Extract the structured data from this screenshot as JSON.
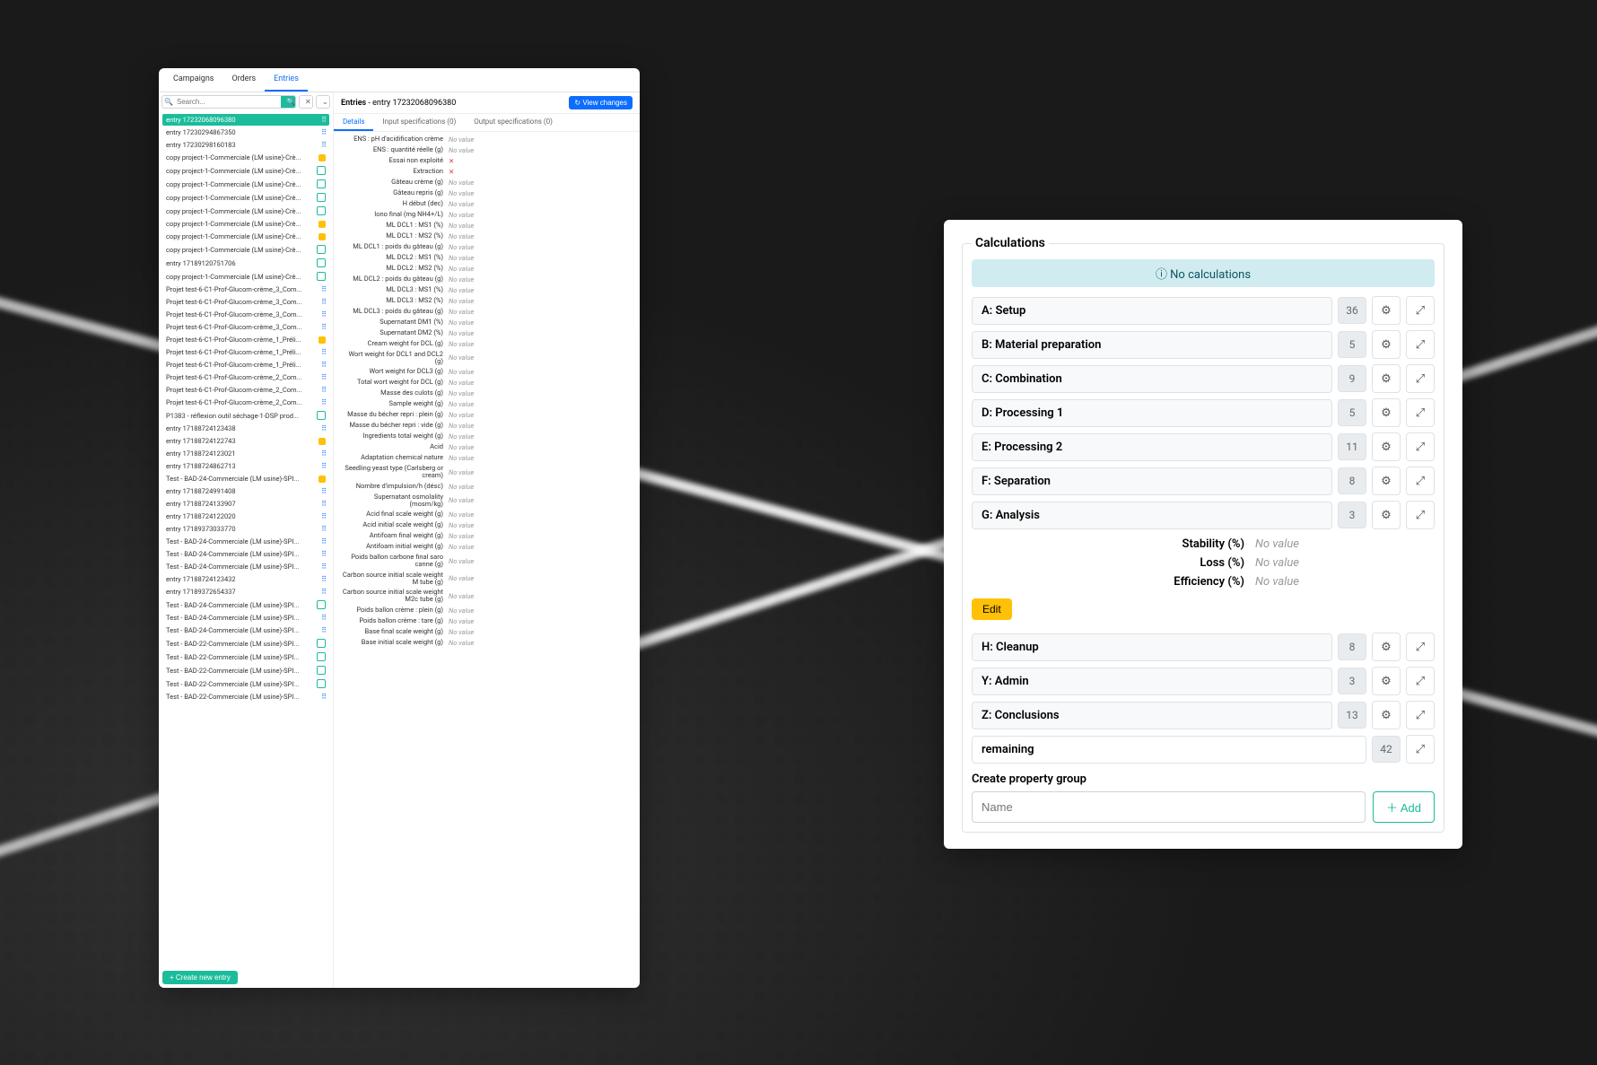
{
  "leftWindow": {
    "tabs": [
      "Campaigns",
      "Orders",
      "Entries"
    ],
    "activeTab": 2,
    "search": {
      "placeholder": "Search..."
    },
    "createLabel": "+  Create new entry",
    "entries": [
      {
        "label": "entry 17232068096380",
        "icon": "drag",
        "sel": true
      },
      {
        "label": "entry 17230294867350",
        "icon": "drag"
      },
      {
        "label": "entry 17230298160183",
        "icon": "drag"
      },
      {
        "label": "copy project-1-Commerciale (LM usine)-Crè...",
        "icon": "y"
      },
      {
        "label": "copy project-1-Commerciale (LM usine)-Crè...",
        "icon": "g"
      },
      {
        "label": "copy project-1-Commerciale (LM usine)-Crè...",
        "icon": "g"
      },
      {
        "label": "copy project-1-Commerciale (LM usine)-Crè...",
        "icon": "g"
      },
      {
        "label": "copy project-1-Commerciale (LM usine)-Crè...",
        "icon": "g"
      },
      {
        "label": "copy project-1-Commerciale (LM usine)-Crè...",
        "icon": "y"
      },
      {
        "label": "copy project-1-Commerciale (LM usine)-Crè...",
        "icon": "y"
      },
      {
        "label": "copy project-1-Commerciale (LM usine)-Crè...",
        "icon": "g"
      },
      {
        "label": "entry 17189120751706",
        "icon": "g"
      },
      {
        "label": "copy project-1-Commerciale (LM usine)-Crè...",
        "icon": "g"
      },
      {
        "label": "Projet test-6-C1-Prof-Glucom-crème_3_Com...",
        "icon": "drag"
      },
      {
        "label": "Projet test-6-C1-Prof-Glucom-crème_3_Com...",
        "icon": "drag"
      },
      {
        "label": "Projet test-6-C1-Prof-Glucom-crème_3_Com...",
        "icon": "drag"
      },
      {
        "label": "Projet test-6-C1-Prof-Glucom-crème_3_Com...",
        "icon": "drag"
      },
      {
        "label": "Projet test-6-C1-Prof-Glucom-crème_1_Préli...",
        "icon": "y"
      },
      {
        "label": "Projet test-6-C1-Prof-Glucom-crème_1_Préli...",
        "icon": "drag"
      },
      {
        "label": "Projet test-6-C1-Prof-Glucom-crème_1_Préli...",
        "icon": "drag"
      },
      {
        "label": "Projet test-6-C1-Prof-Glucom-crème_2_Com...",
        "icon": "drag"
      },
      {
        "label": "Projet test-6-C1-Prof-Glucom-crème_2_Com...",
        "icon": "drag"
      },
      {
        "label": "Projet test-6-C1-Prof-Glucom-crème_2_Com...",
        "icon": "drag"
      },
      {
        "label": "P1383 - réflexion outil séchage-1-DSP prod...",
        "icon": "g"
      },
      {
        "label": "entry 17188724123438",
        "icon": "drag"
      },
      {
        "label": "entry 17188724122743",
        "icon": "y"
      },
      {
        "label": "entry 17188724123021",
        "icon": "drag"
      },
      {
        "label": "entry 17188724862713",
        "icon": "drag"
      },
      {
        "label": "Test - BAD-24-Commerciale (LM usine)-SPI...",
        "icon": "y"
      },
      {
        "label": "entry 17188724991408",
        "icon": "drag"
      },
      {
        "label": "entry 17188724133907",
        "icon": "drag"
      },
      {
        "label": "entry 17188724122020",
        "icon": "drag"
      },
      {
        "label": "entry 17189373033770",
        "icon": "drag"
      },
      {
        "label": "Test - BAD-24-Commerciale (LM usine)-SPI...",
        "icon": "drag"
      },
      {
        "label": "Test - BAD-24-Commerciale (LM usine)-SPI...",
        "icon": "drag"
      },
      {
        "label": "Test - BAD-24-Commerciale (LM usine)-SPI...",
        "icon": "drag"
      },
      {
        "label": "entry 17188724123432",
        "icon": "drag"
      },
      {
        "label": "entry 17189372654337",
        "icon": "drag"
      },
      {
        "label": "Test - BAD-24-Commerciale (LM usine)-SPI...",
        "icon": "g"
      },
      {
        "label": "Test - BAD-24-Commerciale (LM usine)-SPI...",
        "icon": "drag"
      },
      {
        "label": "Test - BAD-24-Commerciale (LM usine)-SPI...",
        "icon": "drag"
      },
      {
        "label": "Test - BAD-22-Commerciale (LM usine)-SPI...",
        "icon": "g"
      },
      {
        "label": "Test - BAD-22-Commerciale (LM usine)-SPI...",
        "icon": "g"
      },
      {
        "label": "Test - BAD-22-Commerciale (LM usine)-SPI...",
        "icon": "g"
      },
      {
        "label": "Test - BAD-22-Commerciale (LM usine)-SPI...",
        "icon": "g"
      },
      {
        "label": "Test - BAD-22-Commerciale (LM usine)-SPI...",
        "icon": "drag"
      }
    ],
    "rightHeader": {
      "prefix": "Entries",
      "sep": " - ",
      "name": "entry 17232068096380",
      "viewBtn": "↻ View changes"
    },
    "subTabs": [
      "Details",
      "Input specifications (0)",
      "Output specifications (0)"
    ],
    "activeSubTab": 0,
    "details": [
      {
        "l": "ENS : pH d'acidification crème",
        "v": "No value"
      },
      {
        "l": "ENS : quantité réelle (g)",
        "v": "No value"
      },
      {
        "l": "Essai non exploité",
        "v": "✕",
        "x": true
      },
      {
        "l": "Extraction",
        "v": "✕",
        "x": true
      },
      {
        "l": "Gâteau crème (g)",
        "v": "No value"
      },
      {
        "l": "Gâteau repris (g)",
        "v": "No value"
      },
      {
        "l": "H début (dec)",
        "v": "No value"
      },
      {
        "l": "Iono final (mg NH4+/L)",
        "v": "No value"
      },
      {
        "l": "ML DCL1 : MS1 (%)",
        "v": "No value"
      },
      {
        "l": "ML DCL1 : MS2 (%)",
        "v": "No value"
      },
      {
        "l": "ML DCL1 : poids du gâteau (g)",
        "v": "No value"
      },
      {
        "l": "ML DCL2 : MS1 (%)",
        "v": "No value"
      },
      {
        "l": "ML DCL2 : MS2 (%)",
        "v": "No value"
      },
      {
        "l": "ML DCL2 : poids du gâteau (g)",
        "v": "No value"
      },
      {
        "l": "ML DCL3 : MS1 (%)",
        "v": "No value"
      },
      {
        "l": "ML DCL3 : MS2 (%)",
        "v": "No value"
      },
      {
        "l": "ML DCL3 : poids du gâteau (g)",
        "v": "No value"
      },
      {
        "l": "Supernatant DM1 (%)",
        "v": "No value"
      },
      {
        "l": "Supernatant DM2 (%)",
        "v": "No value"
      },
      {
        "l": "Cream weight for DCL (g)",
        "v": "No value"
      },
      {
        "l": "Wort weight for DCL1 and DCL2 (g)",
        "v": "No value"
      },
      {
        "l": "Wort weight for DCL3 (g)",
        "v": "No value"
      },
      {
        "l": "Total wort weight for DCL (g)",
        "v": "No value"
      },
      {
        "l": "Masse des culots (g)",
        "v": "No value"
      },
      {
        "l": "Sample weight (g)",
        "v": "No value"
      },
      {
        "l": "Masse du bécher repri : plein (g)",
        "v": "No value"
      },
      {
        "l": "Masse du bécher repri : vide (g)",
        "v": "No value"
      },
      {
        "l": "Ingredients total weight (g)",
        "v": "No value"
      },
      {
        "l": "Acid",
        "v": "No value"
      },
      {
        "l": "Adaptation chemical nature",
        "v": "No value"
      },
      {
        "l": "Seedling yeast type (Carlsberg or cream)",
        "v": "No value"
      },
      {
        "l": "Nombre d'impulsion/h (désc)",
        "v": "No value"
      },
      {
        "l": "Supernatant osmolality (mosm/kg)",
        "v": "No value"
      },
      {
        "l": "Acid final scale weight (g)",
        "v": "No value"
      },
      {
        "l": "Acid initial scale weight (g)",
        "v": "No value"
      },
      {
        "l": "Antifoam final weight (g)",
        "v": "No value"
      },
      {
        "l": "Antifoam initial weight (g)",
        "v": "No value"
      },
      {
        "l": "Poids ballon carbone final saro canne (g)",
        "v": "No value"
      },
      {
        "l": "Carbon source initial scale weight M tube (g)",
        "v": "No value"
      },
      {
        "l": "Carbon source initial scale weight M2c tube (g)",
        "v": "No value"
      },
      {
        "l": "Poids ballon crème : plein (g)",
        "v": "No value"
      },
      {
        "l": "Poids ballon crème : tare (g)",
        "v": "No value"
      },
      {
        "l": "Base final scale weight (g)",
        "v": "No value"
      },
      {
        "l": "Base initial scale weight (g)",
        "v": "No value"
      }
    ]
  },
  "rightWindow": {
    "legend": "Calculations",
    "noCalc": "ⓘ No calculations",
    "groups": [
      {
        "name": "A: Setup",
        "count": 36,
        "gear": true,
        "exp": true
      },
      {
        "name": "B: Material preparation",
        "count": 5,
        "gear": true,
        "exp": true
      },
      {
        "name": "C: Combination",
        "count": 9,
        "gear": true,
        "exp": true
      },
      {
        "name": "D: Processing 1",
        "count": 5,
        "gear": true,
        "exp": true
      },
      {
        "name": "E: Processing 2",
        "count": 11,
        "gear": true,
        "exp": true
      },
      {
        "name": "F: Separation",
        "count": 8,
        "gear": true,
        "exp": true
      },
      {
        "name": "G: Analysis",
        "count": 3,
        "gear": true,
        "exp": true,
        "open": true,
        "props": [
          {
            "l": "Stability (%)",
            "v": "No value"
          },
          {
            "l": "Loss (%)",
            "v": "No value"
          },
          {
            "l": "Efficiency (%)",
            "v": "No value"
          }
        ]
      },
      {
        "name": "H: Cleanup",
        "count": 8,
        "gear": true,
        "exp": true
      },
      {
        "name": "Y: Admin",
        "count": 3,
        "gear": true,
        "exp": true
      },
      {
        "name": "Z: Conclusions",
        "count": 13,
        "gear": true,
        "exp": true
      },
      {
        "name": "remaining",
        "count": 42,
        "gear": false,
        "exp": true,
        "plain": true
      }
    ],
    "editLabel": "Edit",
    "createGrpLabel": "Create property group",
    "addPlaceholder": "Name",
    "addLabel": "＋ Add"
  }
}
